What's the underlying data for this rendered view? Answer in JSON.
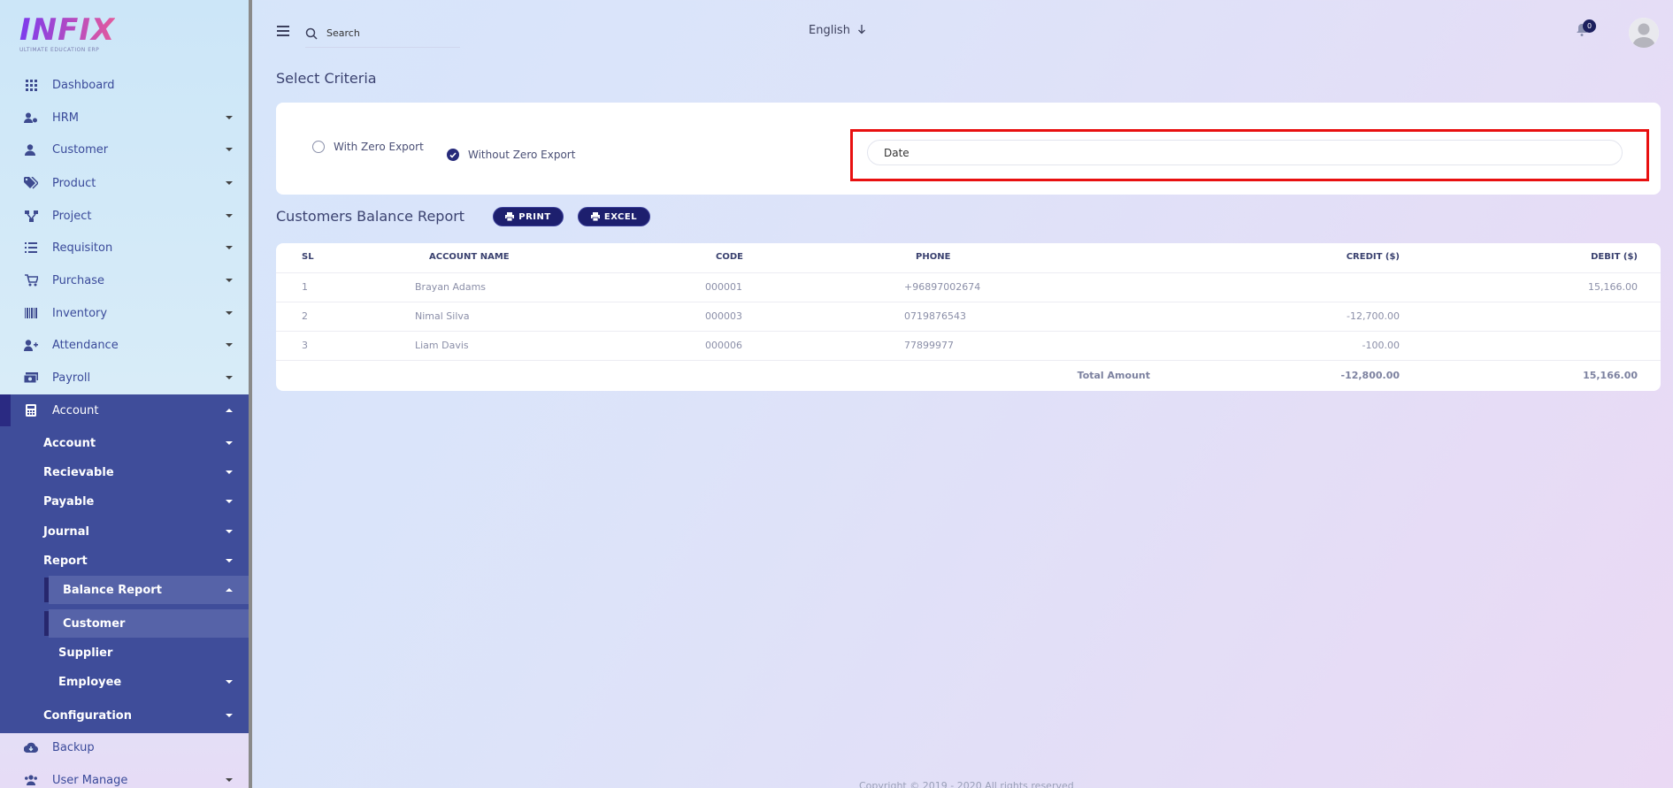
{
  "sidebar": {
    "logo": "INFIX",
    "logo_sub": "ULTIMATE EDUCATION ERP",
    "items": [
      {
        "label": "Dashboard",
        "icon": "grid-icon"
      },
      {
        "label": "HRM",
        "icon": "users-cog-icon"
      },
      {
        "label": "Customer",
        "icon": "user-icon"
      },
      {
        "label": "Product",
        "icon": "tags-icon"
      },
      {
        "label": "Project",
        "icon": "project-diagram-icon"
      },
      {
        "label": "Requisiton",
        "icon": "list-icon"
      },
      {
        "label": "Purchase",
        "icon": "shopping-cart-icon"
      },
      {
        "label": "Inventory",
        "icon": "barcode-icon"
      },
      {
        "label": "Attendance",
        "icon": "user-plus-icon"
      },
      {
        "label": "Payroll",
        "icon": "money-bill-icon"
      },
      {
        "label": "Account",
        "icon": "calculator-icon"
      },
      {
        "label": "Backup",
        "icon": "cloud-download-icon"
      },
      {
        "label": "User Manage",
        "icon": "users-icon"
      }
    ],
    "account_sub": [
      "Account",
      "Recievable",
      "Payable",
      "Journal",
      "Report",
      "Balance Report",
      "Customer",
      "Supplier",
      "Employee",
      "Configuration"
    ]
  },
  "header": {
    "search_placeholder": "Search",
    "language": "English",
    "notification_count": "0"
  },
  "main": {
    "page_title": "Select Criteria",
    "radio_with_zero": "With Zero Export",
    "radio_without_zero": "Without Zero Export",
    "date_placeholder": "Date",
    "report_title": "Customers Balance Report",
    "print_label": "PRINT",
    "excel_label": "EXCEL",
    "columns": [
      "SL",
      "ACCOUNT NAME",
      "CODE",
      "PHONE",
      "CREDIT ($)",
      "DEBIT ($)"
    ],
    "rows": [
      {
        "sl": "1",
        "name": "Brayan Adams",
        "code": "000001",
        "phone": "+96897002674",
        "credit": "",
        "debit": "15,166.00"
      },
      {
        "sl": "2",
        "name": "Nimal Silva",
        "code": "000003",
        "phone": "0719876543",
        "credit": "-12,700.00",
        "debit": ""
      },
      {
        "sl": "3",
        "name": "Liam Davis",
        "code": "000006",
        "phone": "77899977",
        "credit": "-100.00",
        "debit": ""
      }
    ],
    "total_label": "Total Amount",
    "total_credit": "-12,800.00",
    "total_debit": "15,166.00"
  },
  "footer": "Copyright © 2019 - 2020 All rights reserved"
}
